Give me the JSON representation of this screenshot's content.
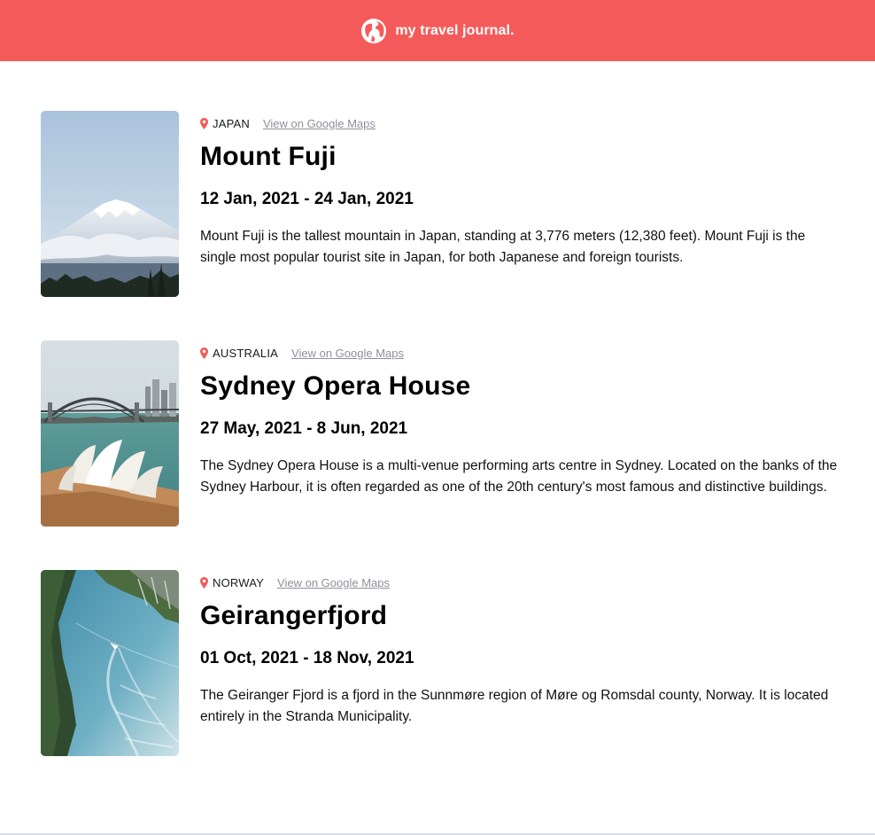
{
  "header": {
    "title": "my travel journal.",
    "icon": "globe-icon",
    "background_color": "#f55a5a"
  },
  "entries": [
    {
      "country": "JAPAN",
      "map_link": "View on Google Maps",
      "title": "Mount Fuji",
      "dates": "12 Jan, 2021 - 24 Jan, 2021",
      "description": "Mount Fuji is the tallest mountain in Japan, standing at 3,776 meters (12,380 feet). Mount Fuji is the single most popular tourist site in Japan, for both Japanese and foreign tourists.",
      "image": "mount-fuji-photo"
    },
    {
      "country": "AUSTRALIA",
      "map_link": "View on Google Maps",
      "title": "Sydney Opera House",
      "dates": "27 May, 2021 - 8 Jun, 2021",
      "description": "The Sydney Opera House is a multi-venue performing arts centre in Sydney. Located on the banks of the Sydney Harbour, it is often regarded as one of the 20th century's most famous and distinctive buildings.",
      "image": "sydney-opera-house-photo"
    },
    {
      "country": "NORWAY",
      "map_link": "View on Google Maps",
      "title": "Geirangerfjord",
      "dates": "01 Oct, 2021 - 18 Nov, 2021",
      "description": "The Geiranger Fjord is a fjord in the Sunnmøre region of Møre og Romsdal county, Norway. It is located entirely in the Stranda Municipality.",
      "image": "geirangerfjord-photo"
    }
  ],
  "colors": {
    "pin": "#f55a5a",
    "link": "#918e9b"
  }
}
